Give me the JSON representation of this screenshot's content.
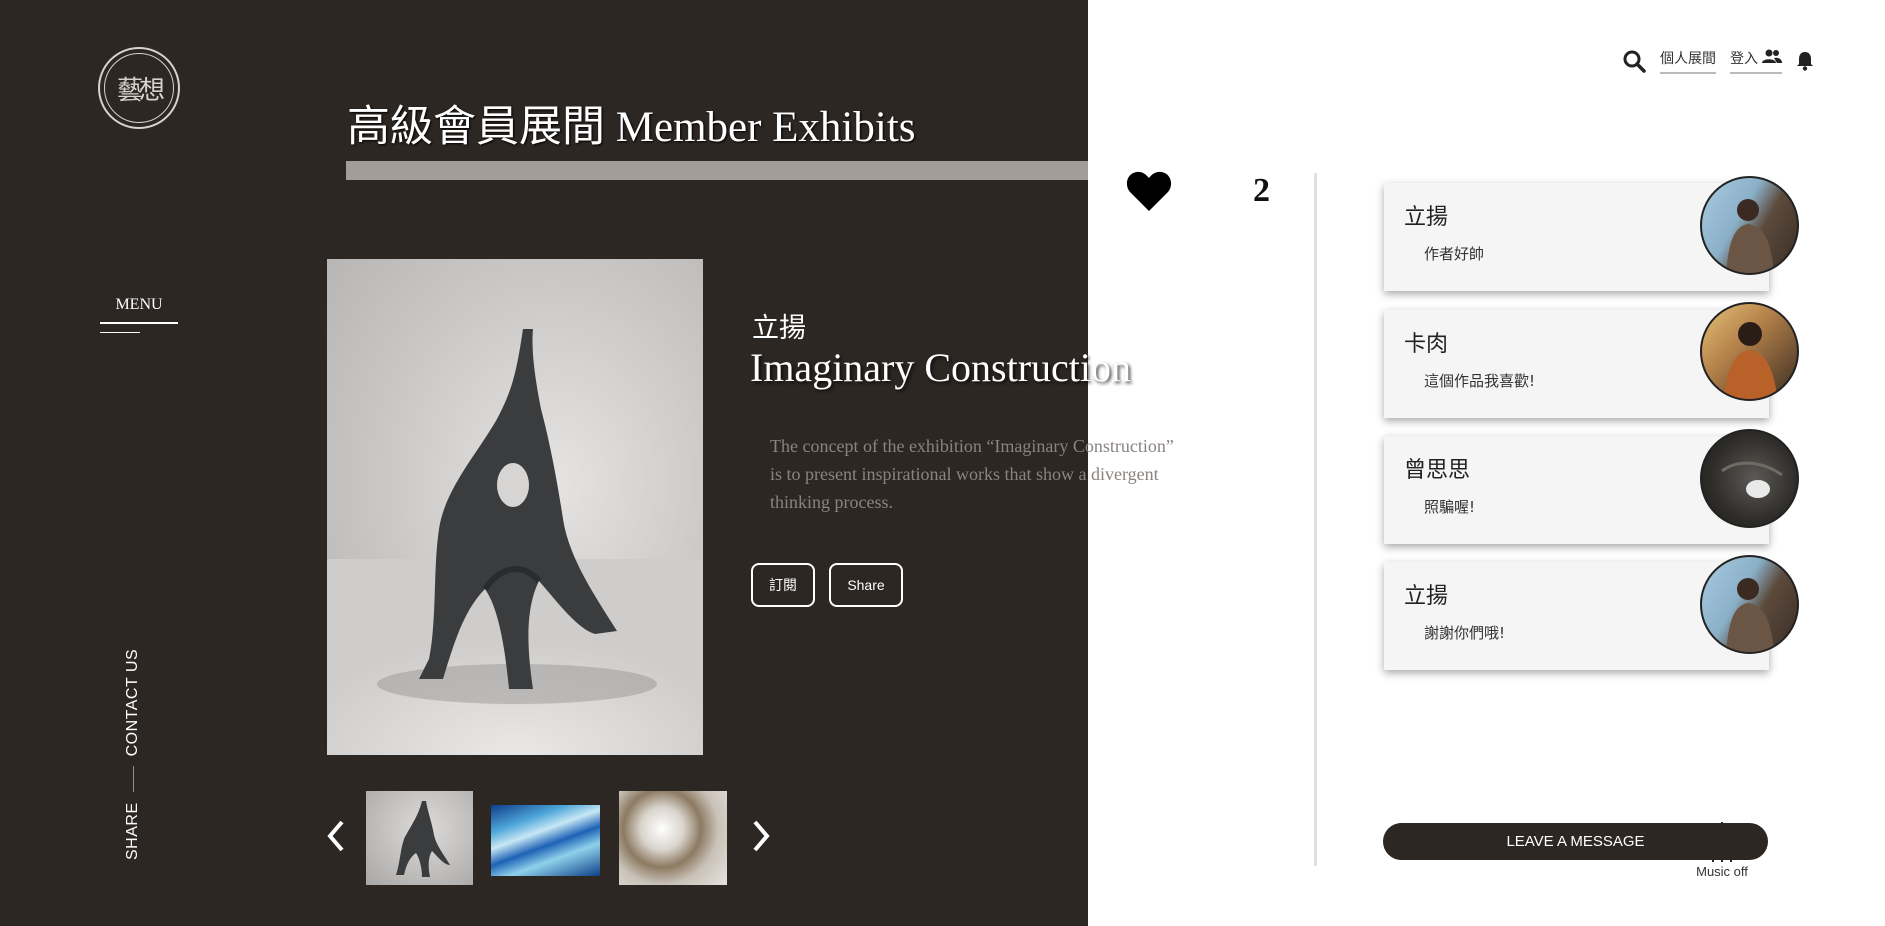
{
  "sidebar": {
    "logo_text": "藝想",
    "menu_label": "MENU",
    "contact_label": "CONTACT US",
    "share_label": "SHARE"
  },
  "header": {
    "title": "高級會員展間 Member Exhibits",
    "nav": {
      "personal_exhibit": "個人展間",
      "login": "登入"
    },
    "icons": [
      "search-icon",
      "users-icon",
      "bell-icon"
    ]
  },
  "exhibit": {
    "artist": "立揚",
    "title": "Imaginary Construction",
    "description": "The concept of the exhibition “Imaginary Construction” is to present inspirational works that show a divergent thinking process.",
    "subscribe_label": "訂閱",
    "share_label": "Share",
    "thumbnails": [
      "thumbnail-sculpture",
      "thumbnail-blue-glass",
      "thumbnail-wave"
    ]
  },
  "likes": {
    "count": "2",
    "icon": "heart-icon"
  },
  "comments": [
    {
      "name": "立揚",
      "text": "作者好帥"
    },
    {
      "name": "卡肉",
      "text": "這個作品我喜歡!"
    },
    {
      "name": "曾思思",
      "text": "照騙喔!"
    },
    {
      "name": "立揚",
      "text": "謝謝你們哦!"
    }
  ],
  "footer": {
    "leave_message_label": "LEAVE A MESSAGE",
    "music_label": "Music off"
  },
  "colors": {
    "dark_panel": "#2d2724",
    "title_bar": "#a29d99",
    "accent": "#a08a6e"
  }
}
